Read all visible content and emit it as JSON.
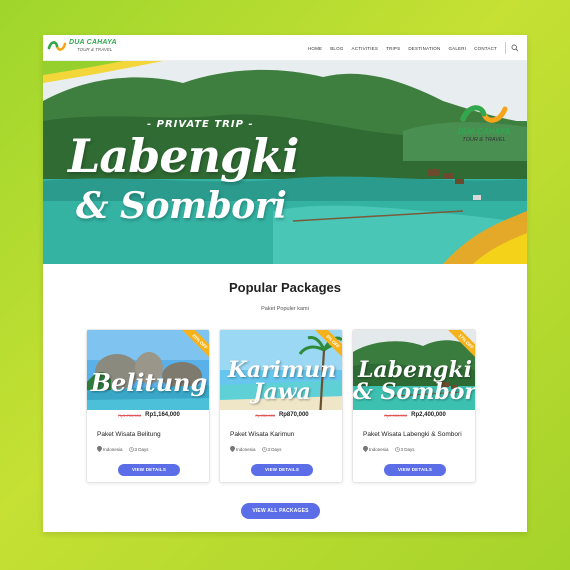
{
  "brand": {
    "name": "DUA CAHAYA",
    "tagline": "TOUR & TRAVEL",
    "colors": {
      "green": "#2fa84f",
      "orange": "#f6a51a",
      "accent_blue": "#5b6ee8",
      "background_lime": "#b8dc2f"
    }
  },
  "nav": {
    "items": [
      "HOME",
      "BLOG",
      "ACTIVITIES",
      "TRIPS",
      "DESTINATION",
      "GALERI",
      "CONTACT"
    ],
    "search_icon": "search-icon"
  },
  "hero": {
    "kicker": "- PRIVATE TRIP -",
    "title_line1": "Labengki",
    "title_line2": "& Sombori"
  },
  "section": {
    "title": "Popular Packages",
    "subtitle": "Paket Populer kami"
  },
  "packages": [
    {
      "image_title": "Belitung",
      "discount": "20% OFF",
      "price_old": "Rp1,700,000",
      "price_new": "Rp1,164,000",
      "name": "Paket Wisata Belitung",
      "location": "Indonesia",
      "duration": "3 Days",
      "button": "VIEW DETAILS"
    },
    {
      "image_title_1": "Karimun",
      "image_title_2": "Jawa",
      "discount": "6% OFF",
      "price_old": "Rp930,000",
      "price_new": "Rp870,000",
      "name": "Paket Wisata Karimun",
      "location": "Indonesia",
      "duration": "3 Days",
      "button": "VIEW DETAILS"
    },
    {
      "image_title_1": "Labengki",
      "image_title_2": "& Sombori",
      "discount": "17% OFF",
      "price_old": "Rp2,900,000",
      "price_new": "Rp2,400,000",
      "name": "Paket Wisata Labengki & Sombori",
      "location": "Indonesia",
      "duration": "3 Days",
      "button": "VIEW DETAILS"
    }
  ],
  "view_all": "VIEW ALL PACKAGES"
}
